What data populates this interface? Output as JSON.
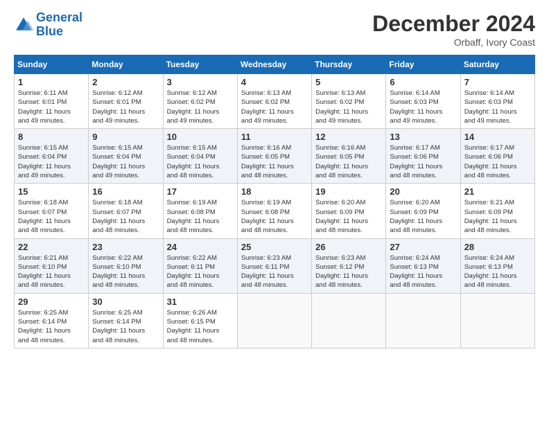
{
  "logo": {
    "line1": "General",
    "line2": "Blue"
  },
  "title": "December 2024",
  "subtitle": "Orbaff, Ivory Coast",
  "weekdays": [
    "Sunday",
    "Monday",
    "Tuesday",
    "Wednesday",
    "Thursday",
    "Friday",
    "Saturday"
  ],
  "weeks": [
    [
      {
        "day": "1",
        "info": "Sunrise: 6:11 AM\nSunset: 6:01 PM\nDaylight: 11 hours\nand 49 minutes."
      },
      {
        "day": "2",
        "info": "Sunrise: 6:12 AM\nSunset: 6:01 PM\nDaylight: 11 hours\nand 49 minutes."
      },
      {
        "day": "3",
        "info": "Sunrise: 6:12 AM\nSunset: 6:02 PM\nDaylight: 11 hours\nand 49 minutes."
      },
      {
        "day": "4",
        "info": "Sunrise: 6:13 AM\nSunset: 6:02 PM\nDaylight: 11 hours\nand 49 minutes."
      },
      {
        "day": "5",
        "info": "Sunrise: 6:13 AM\nSunset: 6:02 PM\nDaylight: 11 hours\nand 49 minutes."
      },
      {
        "day": "6",
        "info": "Sunrise: 6:14 AM\nSunset: 6:03 PM\nDaylight: 11 hours\nand 49 minutes."
      },
      {
        "day": "7",
        "info": "Sunrise: 6:14 AM\nSunset: 6:03 PM\nDaylight: 11 hours\nand 49 minutes."
      }
    ],
    [
      {
        "day": "8",
        "info": "Sunrise: 6:15 AM\nSunset: 6:04 PM\nDaylight: 11 hours\nand 49 minutes."
      },
      {
        "day": "9",
        "info": "Sunrise: 6:15 AM\nSunset: 6:04 PM\nDaylight: 11 hours\nand 49 minutes."
      },
      {
        "day": "10",
        "info": "Sunrise: 6:15 AM\nSunset: 6:04 PM\nDaylight: 11 hours\nand 48 minutes."
      },
      {
        "day": "11",
        "info": "Sunrise: 6:16 AM\nSunset: 6:05 PM\nDaylight: 11 hours\nand 48 minutes."
      },
      {
        "day": "12",
        "info": "Sunrise: 6:16 AM\nSunset: 6:05 PM\nDaylight: 11 hours\nand 48 minutes."
      },
      {
        "day": "13",
        "info": "Sunrise: 6:17 AM\nSunset: 6:06 PM\nDaylight: 11 hours\nand 48 minutes."
      },
      {
        "day": "14",
        "info": "Sunrise: 6:17 AM\nSunset: 6:06 PM\nDaylight: 11 hours\nand 48 minutes."
      }
    ],
    [
      {
        "day": "15",
        "info": "Sunrise: 6:18 AM\nSunset: 6:07 PM\nDaylight: 11 hours\nand 48 minutes."
      },
      {
        "day": "16",
        "info": "Sunrise: 6:18 AM\nSunset: 6:07 PM\nDaylight: 11 hours\nand 48 minutes."
      },
      {
        "day": "17",
        "info": "Sunrise: 6:19 AM\nSunset: 6:08 PM\nDaylight: 11 hours\nand 48 minutes."
      },
      {
        "day": "18",
        "info": "Sunrise: 6:19 AM\nSunset: 6:08 PM\nDaylight: 11 hours\nand 48 minutes."
      },
      {
        "day": "19",
        "info": "Sunrise: 6:20 AM\nSunset: 6:09 PM\nDaylight: 11 hours\nand 48 minutes."
      },
      {
        "day": "20",
        "info": "Sunrise: 6:20 AM\nSunset: 6:09 PM\nDaylight: 11 hours\nand 48 minutes."
      },
      {
        "day": "21",
        "info": "Sunrise: 6:21 AM\nSunset: 6:09 PM\nDaylight: 11 hours\nand 48 minutes."
      }
    ],
    [
      {
        "day": "22",
        "info": "Sunrise: 6:21 AM\nSunset: 6:10 PM\nDaylight: 11 hours\nand 48 minutes."
      },
      {
        "day": "23",
        "info": "Sunrise: 6:22 AM\nSunset: 6:10 PM\nDaylight: 11 hours\nand 48 minutes."
      },
      {
        "day": "24",
        "info": "Sunrise: 6:22 AM\nSunset: 6:11 PM\nDaylight: 11 hours\nand 48 minutes."
      },
      {
        "day": "25",
        "info": "Sunrise: 6:23 AM\nSunset: 6:11 PM\nDaylight: 11 hours\nand 48 minutes."
      },
      {
        "day": "26",
        "info": "Sunrise: 6:23 AM\nSunset: 6:12 PM\nDaylight: 11 hours\nand 48 minutes."
      },
      {
        "day": "27",
        "info": "Sunrise: 6:24 AM\nSunset: 6:13 PM\nDaylight: 11 hours\nand 48 minutes."
      },
      {
        "day": "28",
        "info": "Sunrise: 6:24 AM\nSunset: 6:13 PM\nDaylight: 11 hours\nand 48 minutes."
      }
    ],
    [
      {
        "day": "29",
        "info": "Sunrise: 6:25 AM\nSunset: 6:14 PM\nDaylight: 11 hours\nand 48 minutes."
      },
      {
        "day": "30",
        "info": "Sunrise: 6:25 AM\nSunset: 6:14 PM\nDaylight: 11 hours\nand 48 minutes."
      },
      {
        "day": "31",
        "info": "Sunrise: 6:26 AM\nSunset: 6:15 PM\nDaylight: 11 hours\nand 48 minutes."
      },
      null,
      null,
      null,
      null
    ]
  ]
}
